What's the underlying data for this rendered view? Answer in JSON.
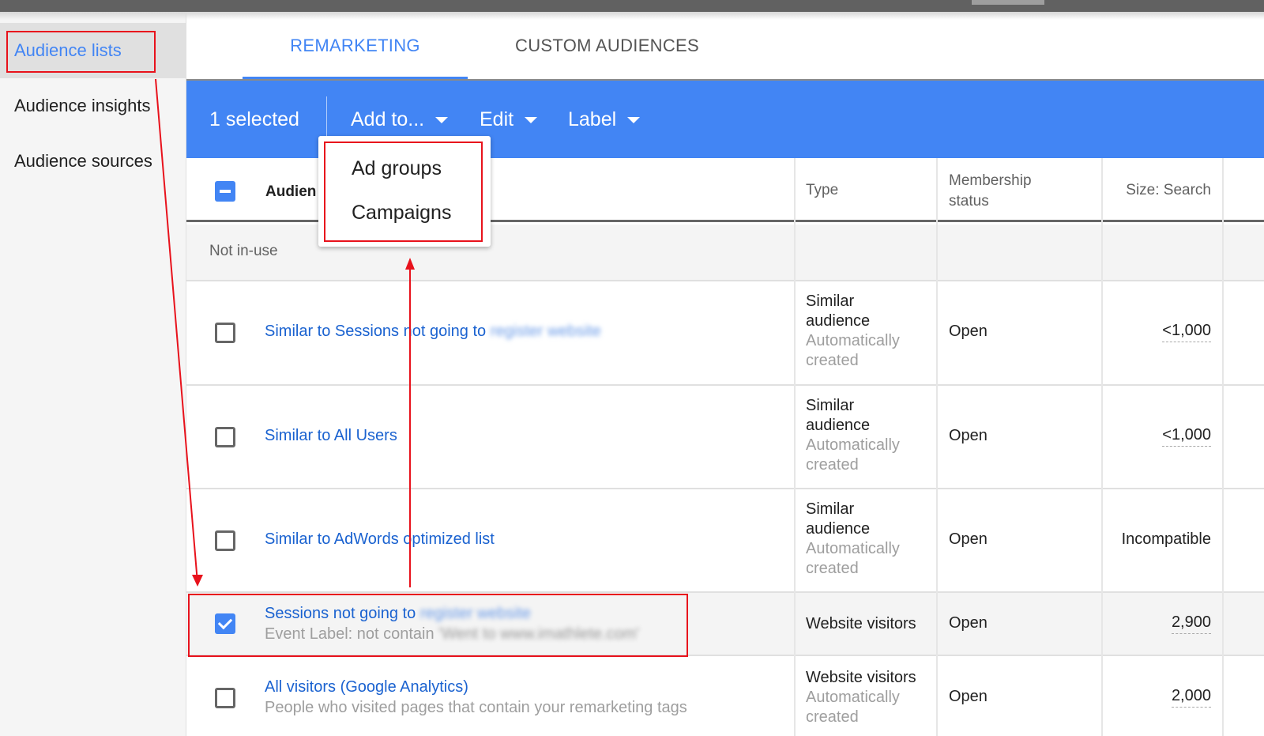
{
  "sidebar": {
    "items": [
      {
        "label": "Audience lists",
        "active": true
      },
      {
        "label": "Audience insights",
        "active": false
      },
      {
        "label": "Audience sources",
        "active": false
      }
    ]
  },
  "tabs": [
    {
      "label": "REMARKETING",
      "active": true
    },
    {
      "label": "CUSTOM AUDIENCES",
      "active": false
    }
  ],
  "actionbar": {
    "selected_label": "1 selected",
    "add_to_label": "Add to...",
    "edit_label": "Edit",
    "label_label": "Label"
  },
  "add_to_menu": {
    "items": [
      "Ad groups",
      "Campaigns"
    ]
  },
  "table": {
    "columns": {
      "name": "Audien",
      "type": "Type",
      "membership_line1": "Membership",
      "membership_line2": "status",
      "size": "Size: Search"
    },
    "group_label": "Not in-use",
    "rows": [
      {
        "name": "Similar to Sessions not going to",
        "name_redacted": "register website",
        "type": "Similar audience",
        "type_line1": "Similar",
        "type_line2": "audience",
        "type_sub1": "Automatically",
        "type_sub2": "created",
        "membership": "Open",
        "size": "<1,000",
        "checked": false
      },
      {
        "name": "Similar to All Users",
        "type_line1": "Similar",
        "type_line2": "audience",
        "type_sub1": "Automatically",
        "type_sub2": "created",
        "membership": "Open",
        "size": "<1,000",
        "checked": false
      },
      {
        "name": "Similar to AdWords optimized list",
        "type_line1": "Similar",
        "type_line2": "audience",
        "type_sub1": "Automatically",
        "type_sub2": "created",
        "membership": "Open",
        "size": "Incompatible",
        "checked": false
      },
      {
        "name": "Sessions not going to",
        "name_redacted": "register website",
        "description": "Event Label: not contain",
        "description_redacted": "'Went to www.imathlete.com'",
        "type_line1": "Website visitors",
        "membership": "Open",
        "size": "2,900",
        "checked": true
      },
      {
        "name": "All visitors (Google Analytics)",
        "description": "People who visited pages that contain your remarketing tags",
        "type_line1": "Website visitors",
        "type_sub1": "Automatically",
        "type_sub2": "created",
        "membership": "Open",
        "size": "2,000",
        "checked": false
      }
    ]
  },
  "colors": {
    "accent_blue": "#4285f4",
    "link_blue": "#1a62d0",
    "annotation_red": "#e8121c"
  }
}
